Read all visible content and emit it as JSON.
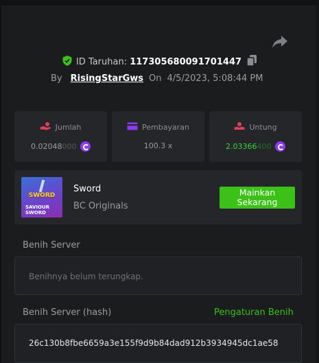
{
  "header": {
    "bet_id_label": "ID Taruhan:",
    "bet_id_value": "117305680091701447",
    "by_label": "By",
    "username": "RisingStarGws",
    "on_label": "On",
    "datetime": "4/5/2023, 5:08:44 PM"
  },
  "stats": {
    "amount": {
      "label": "Jumlah",
      "value_main": "0.02048",
      "value_faded": "000",
      "icon": "coin-hand-icon"
    },
    "payout": {
      "label": "Pembayaran",
      "value": "100.3 x",
      "icon": "card-icon"
    },
    "profit": {
      "label": "Untung",
      "value_main": "2.03366",
      "value_faded": "400",
      "icon": "profit-hand-icon"
    }
  },
  "game": {
    "name": "Sword",
    "provider": "BC Originals",
    "thumb_title": "SWORD",
    "thumb_subtitle": "SAVIOUR SWORD",
    "play_button": "Mainkan Sekarang"
  },
  "server_seed": {
    "label": "Benih Server",
    "placeholder": "Benihnya belum terungkap."
  },
  "server_seed_hash": {
    "label": "Benih Server (hash)",
    "settings_link": "Pengaturan Benih",
    "value": "26c130b8fbe6659a3e155f9d9b84dad912b3934945dc1ae58"
  },
  "colors": {
    "background": "#1b1c1e",
    "panel": "#24262a",
    "accent_green": "#3bc117",
    "coin_purple": "#8a3cf0",
    "red_icon": "#e0405a",
    "purple_icon": "#8a3cf0"
  }
}
